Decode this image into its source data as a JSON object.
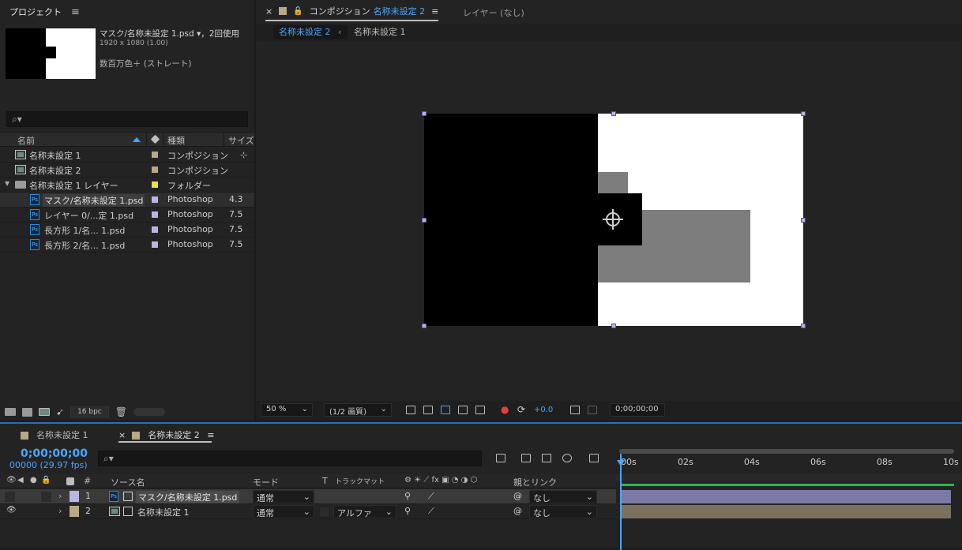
{
  "project": {
    "title": "プロジェクト",
    "menu_icon": "≡",
    "preview_name": "マスク/名称未設定 1.psd ▾，2回使用",
    "preview_dims": "1920 x 1080 (1.00)",
    "preview_color": "数百万色＋ (ストレート)",
    "search_icon": "⌕▾",
    "columns": {
      "name": "名前",
      "type": "種類",
      "size": "サイズ"
    },
    "items": [
      {
        "name": "名称未設定 1",
        "type": "コンポジション",
        "size": "",
        "color": "#b8a886",
        "kind": "comp"
      },
      {
        "name": "名称未設定 2",
        "type": "コンポジション",
        "size": "",
        "color": "#b8a886",
        "kind": "comp"
      },
      {
        "name": "名称未設定 1 レイヤー",
        "type": "フォルダー",
        "size": "",
        "color": "#e6e04a",
        "kind": "folder"
      },
      {
        "name": "マスク/名称未設定 1.psd",
        "type": "Photoshop",
        "size": "4.3",
        "color": "#b9b6e6",
        "kind": "ps"
      },
      {
        "name": "レイヤー 0/...定 1.psd",
        "type": "Photoshop",
        "size": "7.5",
        "color": "#b9b6e6",
        "kind": "ps"
      },
      {
        "name": "長方形 1/名... 1.psd",
        "type": "Photoshop",
        "size": "7.5",
        "color": "#b9b6e6",
        "kind": "ps"
      },
      {
        "name": "長方形 2/名... 1.psd",
        "type": "Photoshop",
        "size": "7.5",
        "color": "#b9b6e6",
        "kind": "ps"
      }
    ],
    "bpc": "16 bpc"
  },
  "composition": {
    "close": "×",
    "tab_label": "コンポジション",
    "tab_comp_name": "名称未設定 2",
    "menu_icon": "≡",
    "layer_label": "レイヤー (なし)",
    "bread_active": "名称未設定 2",
    "bread_arrow": "‹",
    "bread_other": "名称未設定 1",
    "zoom": "50 %",
    "resolution": "(1/2 画質)",
    "exposure": "+0.0",
    "timecode": "0;00;00;00"
  },
  "timeline": {
    "tab1": "名称未設定 1",
    "tab2": "名称未設定 2",
    "close": "×",
    "menu_icon": "≡",
    "time": "0;00;00;00",
    "fps": "00000 (29.97 fps)",
    "search_icon": "⌕▾",
    "headers": {
      "num": "#",
      "source": "ソース名",
      "mode": "モード",
      "t": "T",
      "matte": "トラックマット",
      "parent": "親とリンク"
    },
    "layers": [
      {
        "num": "1",
        "name": "マスク/名称未設定 1.psd",
        "mode": "通常",
        "matte": "",
        "parent": "なし",
        "color": "#b9b6e6"
      },
      {
        "num": "2",
        "name": "名称未設定 1",
        "mode": "通常",
        "matte": "アルファ",
        "parent": "なし",
        "color": "#b8a886"
      }
    ],
    "ruler": [
      "00s",
      "02s",
      "04s",
      "06s",
      "08s",
      "10s"
    ],
    "accent": "#4aa5ff"
  }
}
